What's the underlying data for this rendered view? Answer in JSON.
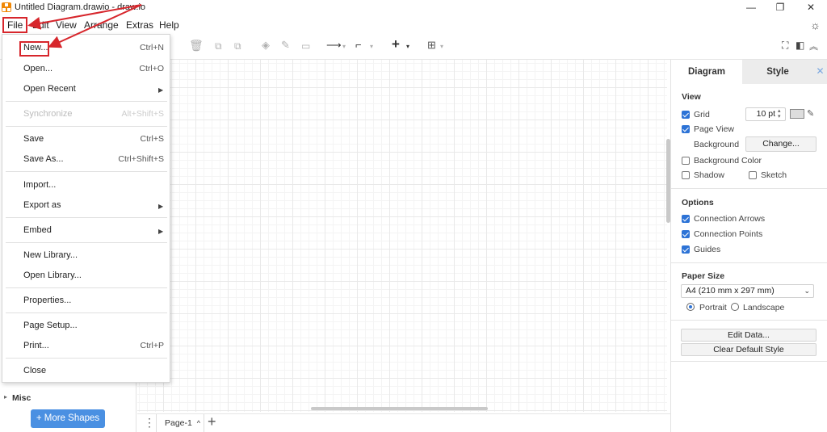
{
  "window": {
    "title": "Untitled Diagram.drawio - draw.io",
    "minimize": "—",
    "maximize": "❐",
    "close": "✕"
  },
  "menubar": {
    "items": [
      "File",
      "Edit",
      "View",
      "Arrange",
      "Extras",
      "Help"
    ]
  },
  "file_menu": {
    "items": [
      {
        "label": "New...",
        "shortcut": "Ctrl+N"
      },
      {
        "label": "Open...",
        "shortcut": "Ctrl+O"
      },
      {
        "label": "Open Recent",
        "submenu": true
      },
      {
        "label": "Synchronize",
        "shortcut": "Alt+Shift+S",
        "disabled": true
      },
      {
        "label": "Save",
        "shortcut": "Ctrl+S"
      },
      {
        "label": "Save As...",
        "shortcut": "Ctrl+Shift+S"
      },
      {
        "label": "Import..."
      },
      {
        "label": "Export as",
        "submenu": true
      },
      {
        "label": "Embed",
        "submenu": true
      },
      {
        "label": "New Library..."
      },
      {
        "label": "Open Library..."
      },
      {
        "label": "Properties..."
      },
      {
        "label": "Page Setup..."
      },
      {
        "label": "Print...",
        "shortcut": "Ctrl+P"
      },
      {
        "label": "Close"
      }
    ]
  },
  "sidebar": {
    "misc_label": "Misc",
    "more_shapes_label": "+ More Shapes"
  },
  "pages": {
    "current": "Page-1",
    "add_icon": "+"
  },
  "format_panel": {
    "tabs": [
      "Diagram",
      "Style"
    ],
    "view": {
      "title": "View",
      "grid_label": "Grid",
      "grid_checked": true,
      "grid_size": "10 pt",
      "page_view_label": "Page View",
      "page_view_checked": true,
      "background_label": "Background",
      "change_button": "Change...",
      "background_color_label": "Background Color",
      "background_color_checked": false,
      "shadow_label": "Shadow",
      "shadow_checked": false,
      "sketch_label": "Sketch",
      "sketch_checked": false
    },
    "options": {
      "title": "Options",
      "connection_arrows_label": "Connection Arrows",
      "connection_points_label": "Connection Points",
      "guides_label": "Guides"
    },
    "paper_size": {
      "title": "Paper Size",
      "selected": "A4 (210 mm x 297 mm)",
      "portrait_label": "Portrait",
      "landscape_label": "Landscape",
      "orientation": "Portrait"
    },
    "edit_data_button": "Edit Data...",
    "clear_default_style_button": "Clear Default Style"
  },
  "colors": {
    "accent": "#2d73d6",
    "annotation_red": "#d7262c",
    "more_shapes_button": "#4a90e2",
    "logo": "#f08705"
  }
}
